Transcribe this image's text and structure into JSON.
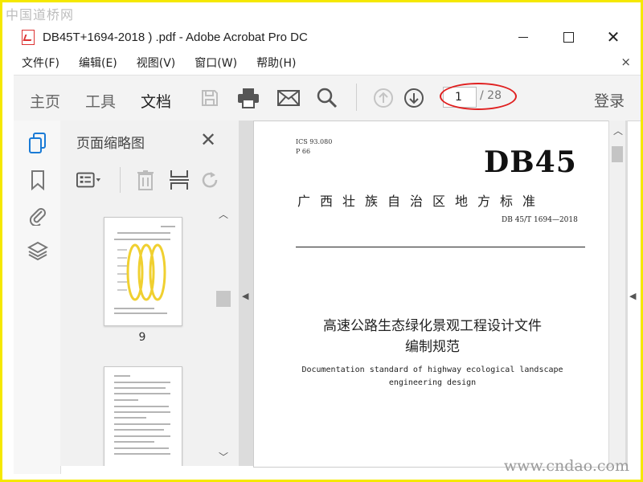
{
  "watermark": {
    "top": "中国道桥网",
    "bottom": "www.cndao.com"
  },
  "window": {
    "title": "DB45T+1694-2018 ) .pdf - Adobe Acrobat Pro DC",
    "minimize": "—",
    "maximize": "☐",
    "close": "✕"
  },
  "menu": {
    "items": [
      "文件(F)",
      "编辑(E)",
      "视图(V)",
      "窗口(W)",
      "帮助(H)"
    ],
    "close": "×"
  },
  "toolbar": {
    "tabs": [
      "主页",
      "工具",
      "文档"
    ],
    "current_page": "1",
    "total_pages": "/ 28",
    "login": "登录"
  },
  "thumb_panel": {
    "title": "页面缩略图",
    "close": "✕",
    "pages": [
      "9"
    ]
  },
  "document": {
    "ics": "ICS 93.080",
    "p": "P 66",
    "code": "DB45",
    "region": "广西壮族自治区地方标准",
    "std_no": "DB 45/T 1694—2018",
    "title_line1": "高速公路生态绿化景观工程设计文件",
    "title_line2": "编制规范",
    "en_title": "Documentation standard of highway ecological landscape engineering design"
  },
  "colors": {
    "frame": "#f5e800",
    "annotation": "#e02020",
    "toolbar_bg": "#f3f3f3"
  }
}
